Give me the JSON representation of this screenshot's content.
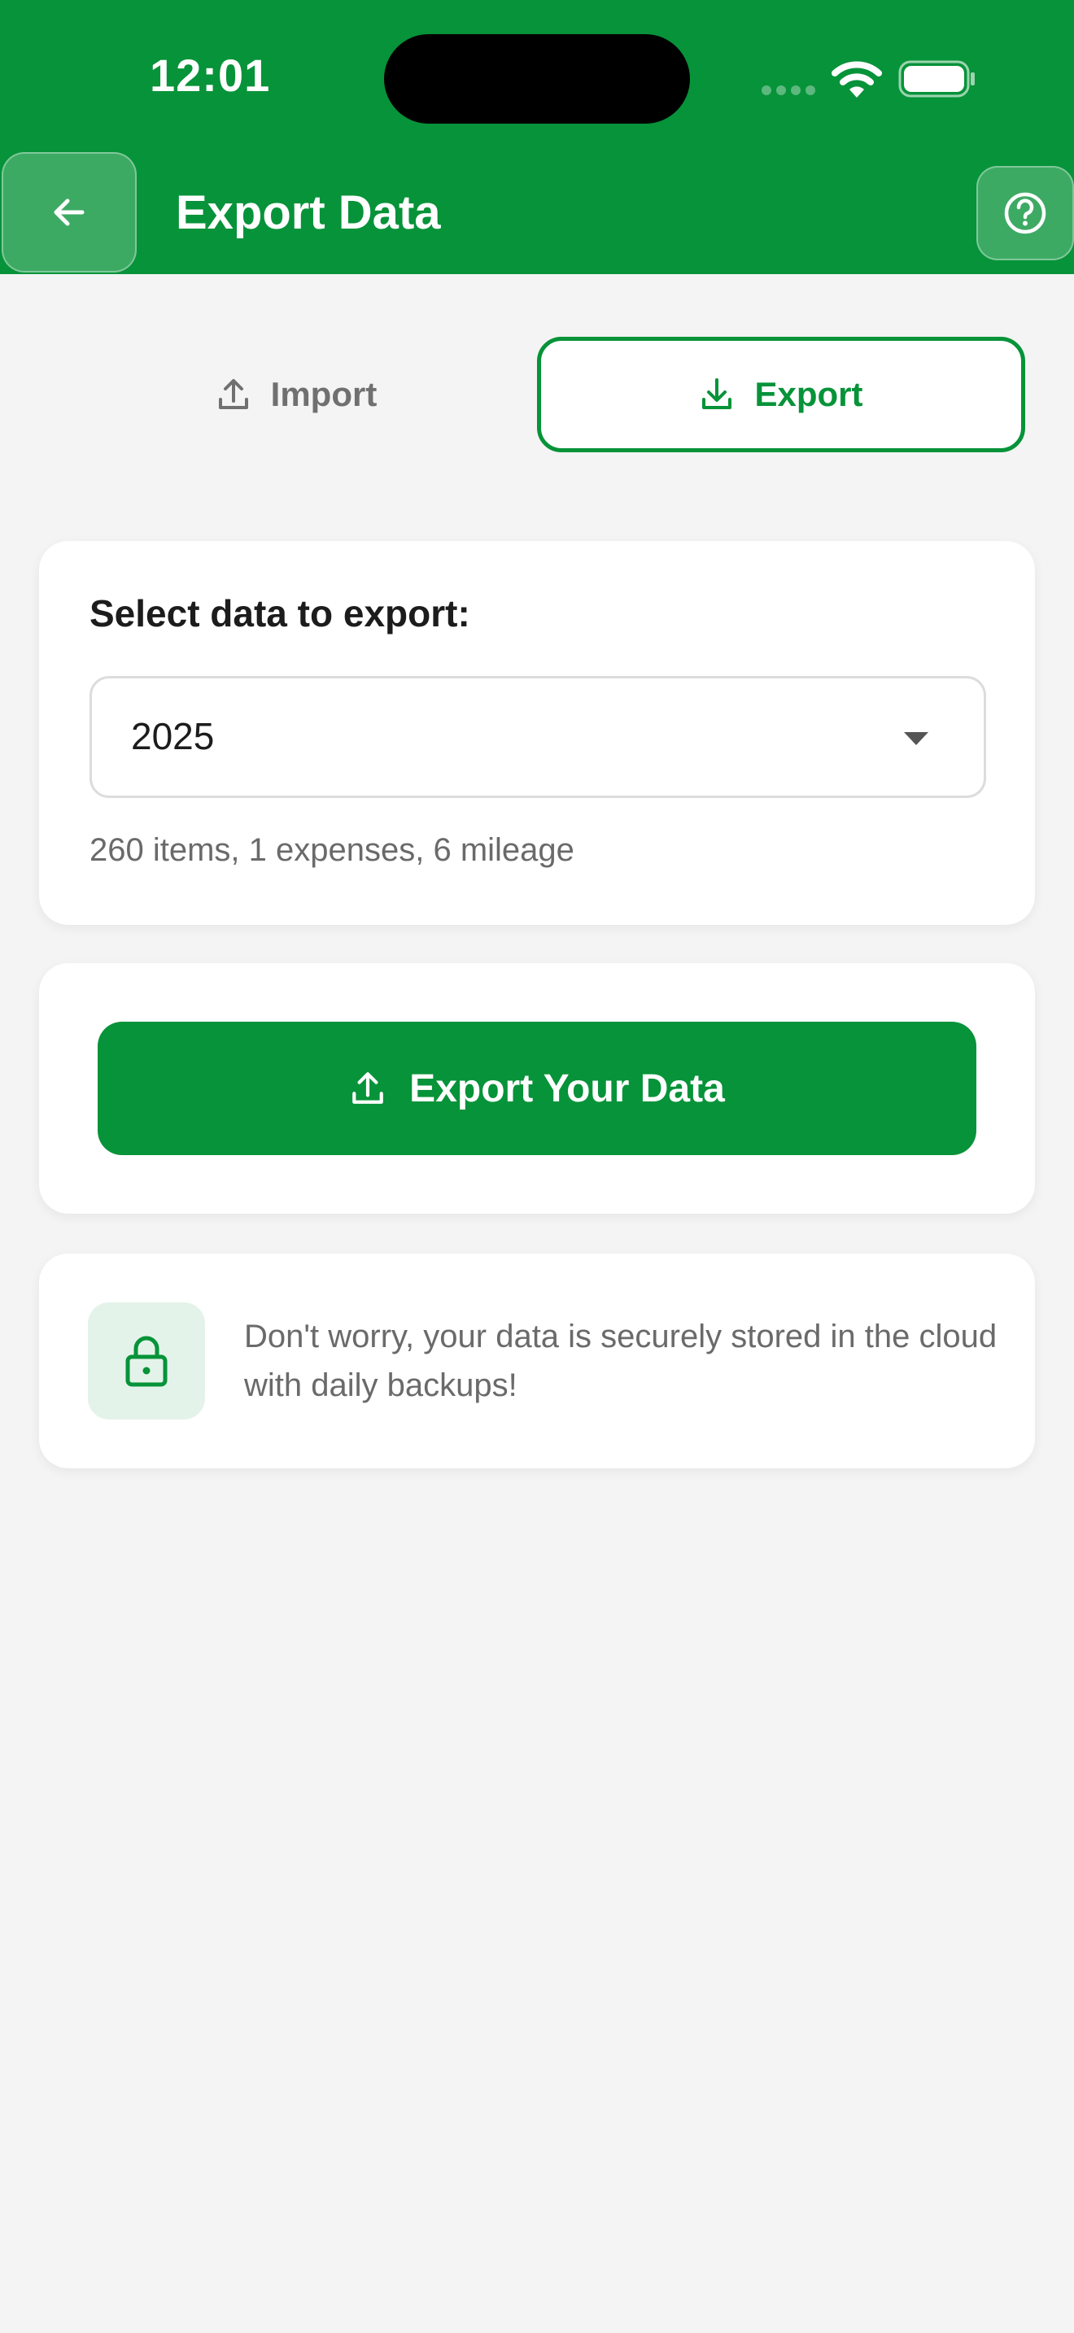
{
  "status_bar": {
    "time": "12:01"
  },
  "header": {
    "title": "Export Data",
    "back_icon": "arrow-left-icon",
    "help_icon": "question-circle-icon"
  },
  "tabs": [
    {
      "label": "Import",
      "icon": "upload-icon",
      "active": false
    },
    {
      "label": "Export",
      "icon": "download-icon",
      "active": true
    }
  ],
  "select_card": {
    "label": "Select data to export:",
    "selected_value": "2025",
    "summary": "260 items, 1 expenses, 6 mileage"
  },
  "export_button": {
    "label": "Export Your Data",
    "icon": "upload-icon"
  },
  "info_card": {
    "icon": "lock-icon",
    "text": "Don't worry, your data is securely stored in the cloud with daily backups!"
  },
  "colors": {
    "brand": "#079339",
    "background": "#f4f4f4",
    "lock_tile": "#e4f3e9"
  }
}
